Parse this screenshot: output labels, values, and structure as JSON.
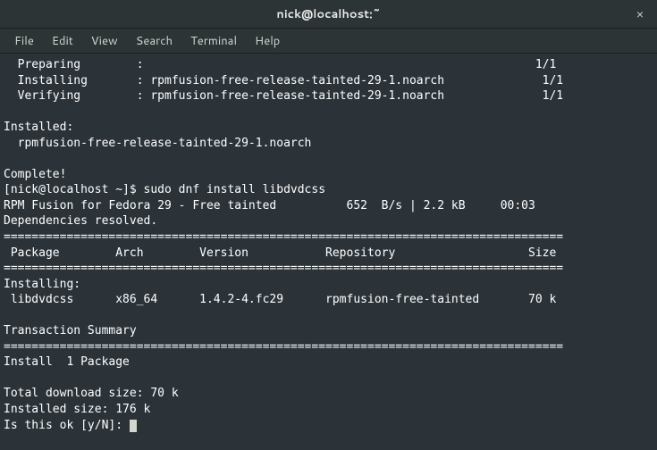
{
  "window": {
    "title": "nick@localhost:~"
  },
  "menubar": {
    "file": "File",
    "edit": "Edit",
    "view": "View",
    "search": "Search",
    "terminal": "Terminal",
    "help": "Help"
  },
  "terminal": {
    "line01": "  Preparing        :                                                        1/1",
    "line02": "  Installing       : rpmfusion-free-release-tainted-29-1.noarch              1/1",
    "line03": "  Verifying        : rpmfusion-free-release-tainted-29-1.noarch              1/1",
    "line04": "",
    "line05": "Installed:",
    "line06": "  rpmfusion-free-release-tainted-29-1.noarch",
    "line07": "",
    "line08": "Complete!",
    "line09": "[nick@localhost ~]$ sudo dnf install libdvdcss",
    "line10": "RPM Fusion for Fedora 29 - Free tainted          652  B/s | 2.2 kB     00:03",
    "line11": "Dependencies resolved.",
    "line12": "================================================================================",
    "line13": " Package        Arch        Version           Repository                   Size",
    "line14": "================================================================================",
    "line15": "Installing:",
    "line16": " libdvdcss      x86_64      1.4.2-4.fc29      rpmfusion-free-tainted       70 k",
    "line17": "",
    "line18": "Transaction Summary",
    "line19": "================================================================================",
    "line20": "Install  1 Package",
    "line21": "",
    "line22": "Total download size: 70 k",
    "line23": "Installed size: 176 k",
    "line24": "Is this ok [y/N]: "
  }
}
